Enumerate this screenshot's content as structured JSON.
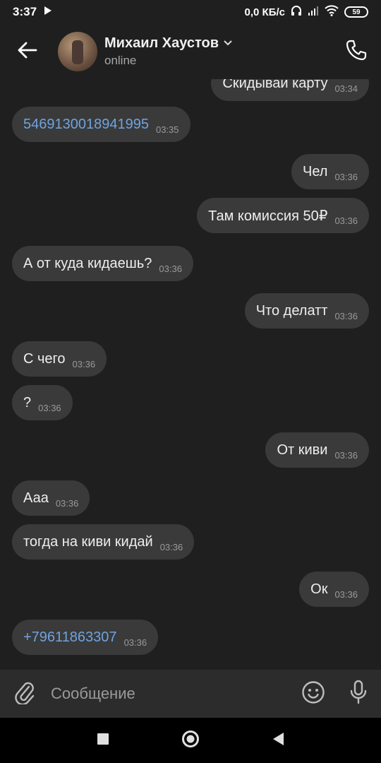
{
  "status_bar": {
    "time": "3:37",
    "network_speed": "0,0 КБ/с",
    "battery": "59"
  },
  "header": {
    "contact_name": "Михаил Хаустов",
    "contact_status": "online"
  },
  "messages": [
    {
      "text": "Скидывай карту",
      "time": "03:34",
      "dir": "out"
    },
    {
      "text": "5469130018941995",
      "time": "03:35",
      "dir": "in",
      "link": true
    },
    {
      "text": "Чел",
      "time": "03:36",
      "dir": "out"
    },
    {
      "text": "Там комиссия 50₽",
      "time": "03:36",
      "dir": "out"
    },
    {
      "text": "А от куда кидаешь?",
      "time": "03:36",
      "dir": "in"
    },
    {
      "text": "Что делатт",
      "time": "03:36",
      "dir": "out"
    },
    {
      "text": "С чего",
      "time": "03:36",
      "dir": "in"
    },
    {
      "text": "?",
      "time": "03:36",
      "dir": "in"
    },
    {
      "text": "От киви",
      "time": "03:36",
      "dir": "out"
    },
    {
      "text": "Ааа",
      "time": "03:36",
      "dir": "in"
    },
    {
      "text": "тогда на киви кидай",
      "time": "03:36",
      "dir": "in"
    },
    {
      "text": "Ок",
      "time": "03:36",
      "dir": "out"
    },
    {
      "text": "+79611863307",
      "time": "03:36",
      "dir": "in",
      "link": true
    }
  ],
  "composer": {
    "placeholder": "Сообщение"
  },
  "icons": {
    "back": "back-arrow-icon",
    "call": "phone-icon",
    "attach": "paperclip-icon",
    "emoji": "emoji-icon",
    "mic": "microphone-icon",
    "nav_recents": "square-icon",
    "nav_home": "circle-icon",
    "nav_back": "triangle-icon"
  },
  "colors": {
    "background": "#1f1f1f",
    "bubble": "#3a3a3a",
    "link": "#6fa3e0",
    "composer": "#2c2c2c"
  }
}
